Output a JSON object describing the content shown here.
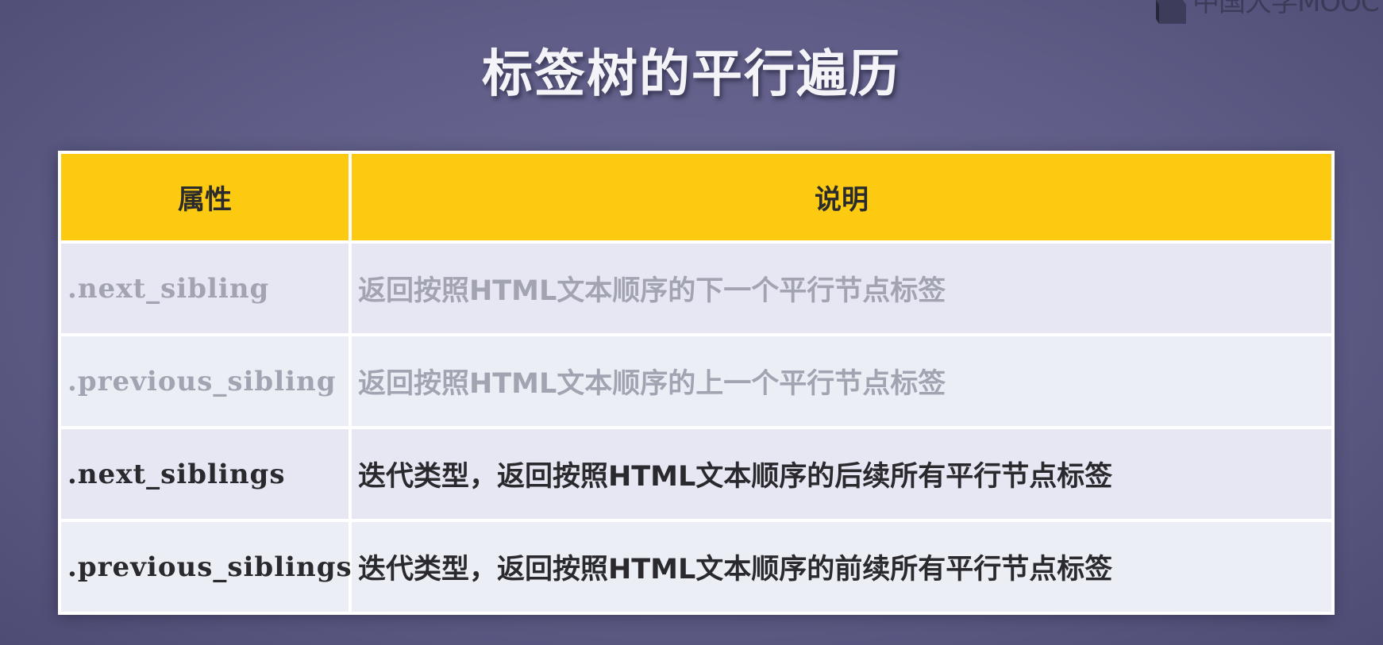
{
  "watermark": {
    "text": "中国大学MOOC"
  },
  "slide": {
    "title": "标签树的平行遍历"
  },
  "table": {
    "headers": {
      "attribute": "属性",
      "description": "说明"
    },
    "rows": [
      {
        "attribute": ".next_sibling",
        "description": "返回按照HTML文本顺序的下一个平行节点标签",
        "tone": "dim"
      },
      {
        "attribute": ".previous_sibling",
        "description": "返回按照HTML文本顺序的上一个平行节点标签",
        "tone": "dim"
      },
      {
        "attribute": ".next_siblings",
        "description": "迭代类型，返回按照HTML文本顺序的后续所有平行节点标签",
        "tone": "dark"
      },
      {
        "attribute": ".previous_siblings",
        "description": "迭代类型，返回按照HTML文本顺序的前续所有平行节点标签",
        "tone": "dark"
      }
    ]
  },
  "colors": {
    "header_background": "#fdca12",
    "row_background": "#e6e7f2",
    "slide_background": "#64628c",
    "dim_text": "#a2a4b2",
    "dark_text": "#2a2a2e"
  },
  "icons": {
    "watermark_logo": "mooc-logo-icon"
  }
}
